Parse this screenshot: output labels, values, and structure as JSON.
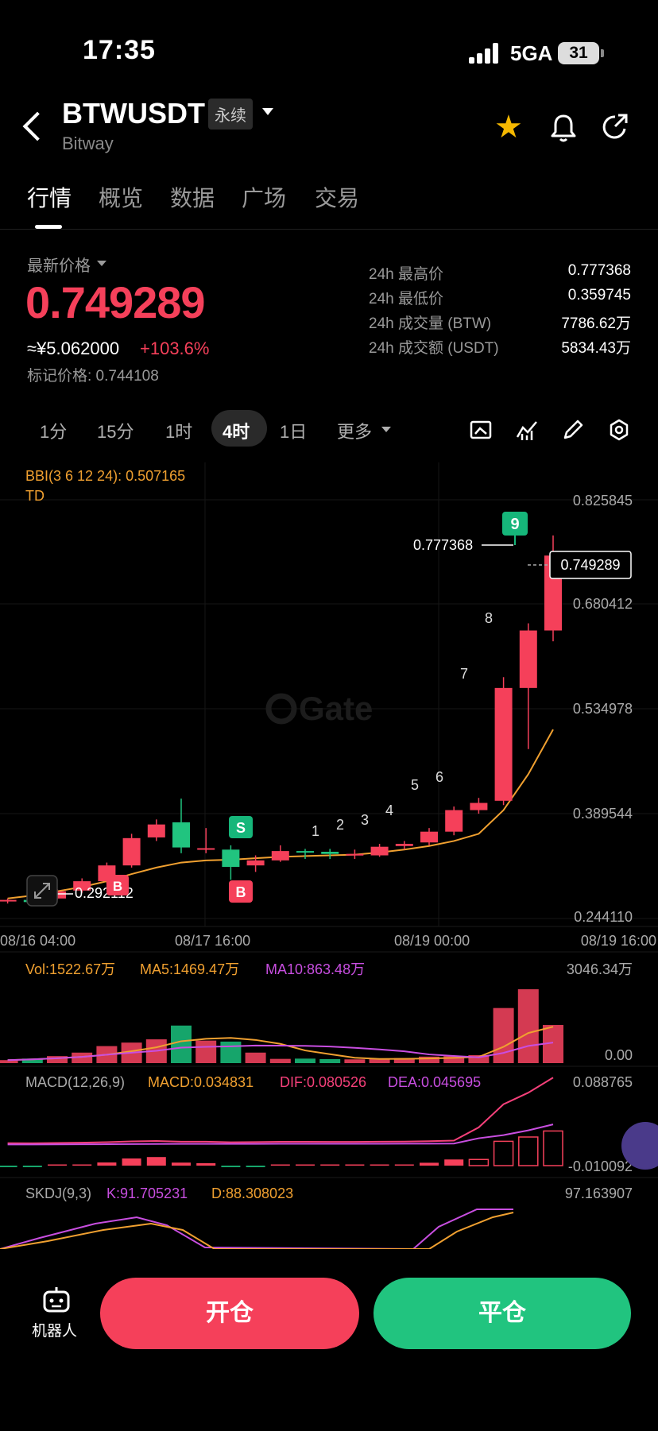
{
  "status_bar": {
    "time": "17:35",
    "network": "5GA",
    "battery": "31"
  },
  "header": {
    "symbol": "BTWUSDT",
    "contract_type": "永续",
    "name": "Bitway",
    "star_icon": "star-icon",
    "colors": {
      "favorite": "#f5b800"
    }
  },
  "tabs": [
    "行情",
    "概览",
    "数据",
    "广场",
    "交易"
  ],
  "price": {
    "label": "最新价格",
    "last": "0.749289",
    "cny": "≈¥5.062000",
    "change": "+103.6%",
    "mark": "标记价格: 0.744108",
    "colors": {
      "up": "#f5405a",
      "down": "#21c47f"
    }
  },
  "stats": [
    {
      "label": "24h 最高价",
      "value": "0.777368"
    },
    {
      "label": "24h 最低价",
      "value": "0.359745"
    },
    {
      "label": "24h 成交量 (BTW)",
      "value": "7786.62万"
    },
    {
      "label": "24h 成交额 (USDT)",
      "value": "5834.43万"
    }
  ],
  "timeframes": [
    "1分",
    "15分",
    "1时",
    "4时",
    "1日",
    "更多"
  ],
  "active_timeframe": "4时",
  "tools": [
    "chart-type-icon",
    "indicator-icon",
    "draw-icon",
    "settings-icon"
  ],
  "chart_labels": {
    "bbi": "BBI(3 6 12 24): 0.507165",
    "td": "TD",
    "y_ticks": [
      "0.825845",
      "0.680412",
      "0.534978",
      "0.389544",
      "0.244110"
    ],
    "x_ticks": [
      "08/16 04:00",
      "08/17 16:00",
      "08/19 00:00",
      "08/19 16:00"
    ],
    "high_label": "0.777368",
    "low_label": "0.292112",
    "current_tag": "0.749289",
    "td_counts": [
      "1",
      "2",
      "3",
      "4",
      "5",
      "6",
      "7",
      "8",
      "9"
    ],
    "signals": {
      "s": "S",
      "b": "B"
    },
    "watermark": "Gate",
    "vol_label": "Vol:1522.67万",
    "ma5_label": "MA5:1469.47万",
    "ma10_label": "MA10:863.48万",
    "vol_max": "3046.34万",
    "vol_zero": "0.00",
    "macd_label": "MACD(12,26,9)",
    "macd_val": "MACD:0.034831",
    "dif_val": "DIF:0.080526",
    "dea_val": "DEA:0.045695",
    "macd_max": "0.088765",
    "macd_min": "-0.010092",
    "skdj_label": "SKDJ(9,3)",
    "k_val": "K:91.705231",
    "d_val": "D:88.308023",
    "skdj_max": "97.163907"
  },
  "chart_data": {
    "type": "candlestick",
    "y_range": [
      0.24411,
      0.825845
    ],
    "candles": [
      {
        "o": 0.268,
        "h": 0.272,
        "l": 0.265,
        "c": 0.27
      },
      {
        "o": 0.27,
        "h": 0.279,
        "l": 0.262,
        "c": 0.267
      },
      {
        "o": 0.272,
        "h": 0.285,
        "l": 0.27,
        "c": 0.282
      },
      {
        "o": 0.283,
        "h": 0.3,
        "l": 0.28,
        "c": 0.296
      },
      {
        "o": 0.296,
        "h": 0.322,
        "l": 0.293,
        "c": 0.318
      },
      {
        "o": 0.318,
        "h": 0.362,
        "l": 0.315,
        "c": 0.356
      },
      {
        "o": 0.357,
        "h": 0.382,
        "l": 0.352,
        "c": 0.375
      },
      {
        "o": 0.378,
        "h": 0.411,
        "l": 0.335,
        "c": 0.343
      },
      {
        "o": 0.342,
        "h": 0.37,
        "l": 0.335,
        "c": 0.342
      },
      {
        "o": 0.34,
        "h": 0.346,
        "l": 0.298,
        "c": 0.316
      },
      {
        "o": 0.318,
        "h": 0.332,
        "l": 0.309,
        "c": 0.325
      },
      {
        "o": 0.325,
        "h": 0.346,
        "l": 0.323,
        "c": 0.338
      },
      {
        "o": 0.338,
        "h": 0.341,
        "l": 0.327,
        "c": 0.337
      },
      {
        "o": 0.337,
        "h": 0.341,
        "l": 0.327,
        "c": 0.334
      },
      {
        "o": 0.333,
        "h": 0.34,
        "l": 0.327,
        "c": 0.334
      },
      {
        "o": 0.332,
        "h": 0.348,
        "l": 0.33,
        "c": 0.344
      },
      {
        "o": 0.345,
        "h": 0.352,
        "l": 0.34,
        "c": 0.348
      },
      {
        "o": 0.35,
        "h": 0.37,
        "l": 0.346,
        "c": 0.365
      },
      {
        "o": 0.365,
        "h": 0.4,
        "l": 0.36,
        "c": 0.395
      },
      {
        "o": 0.395,
        "h": 0.412,
        "l": 0.39,
        "c": 0.405
      },
      {
        "o": 0.408,
        "h": 0.58,
        "l": 0.402,
        "c": 0.565
      },
      {
        "o": 0.565,
        "h": 0.655,
        "l": 0.48,
        "c": 0.645
      },
      {
        "o": 0.645,
        "h": 0.777368,
        "l": 0.63,
        "c": 0.749289
      }
    ],
    "bbi_line": [
      0.272,
      0.276,
      0.282,
      0.288,
      0.296,
      0.306,
      0.315,
      0.322,
      0.325,
      0.326,
      0.328,
      0.33,
      0.331,
      0.332,
      0.333,
      0.336,
      0.34,
      0.345,
      0.352,
      0.362,
      0.395,
      0.445,
      0.507165
    ],
    "volume": [
      120,
      180,
      280,
      420,
      680,
      820,
      950,
      1500,
      900,
      860,
      420,
      170,
      180,
      160,
      150,
      170,
      200,
      260,
      280,
      320,
      2200,
      2950,
      1522.67
    ],
    "volume_range": [
      0,
      3046.34
    ]
  }
}
